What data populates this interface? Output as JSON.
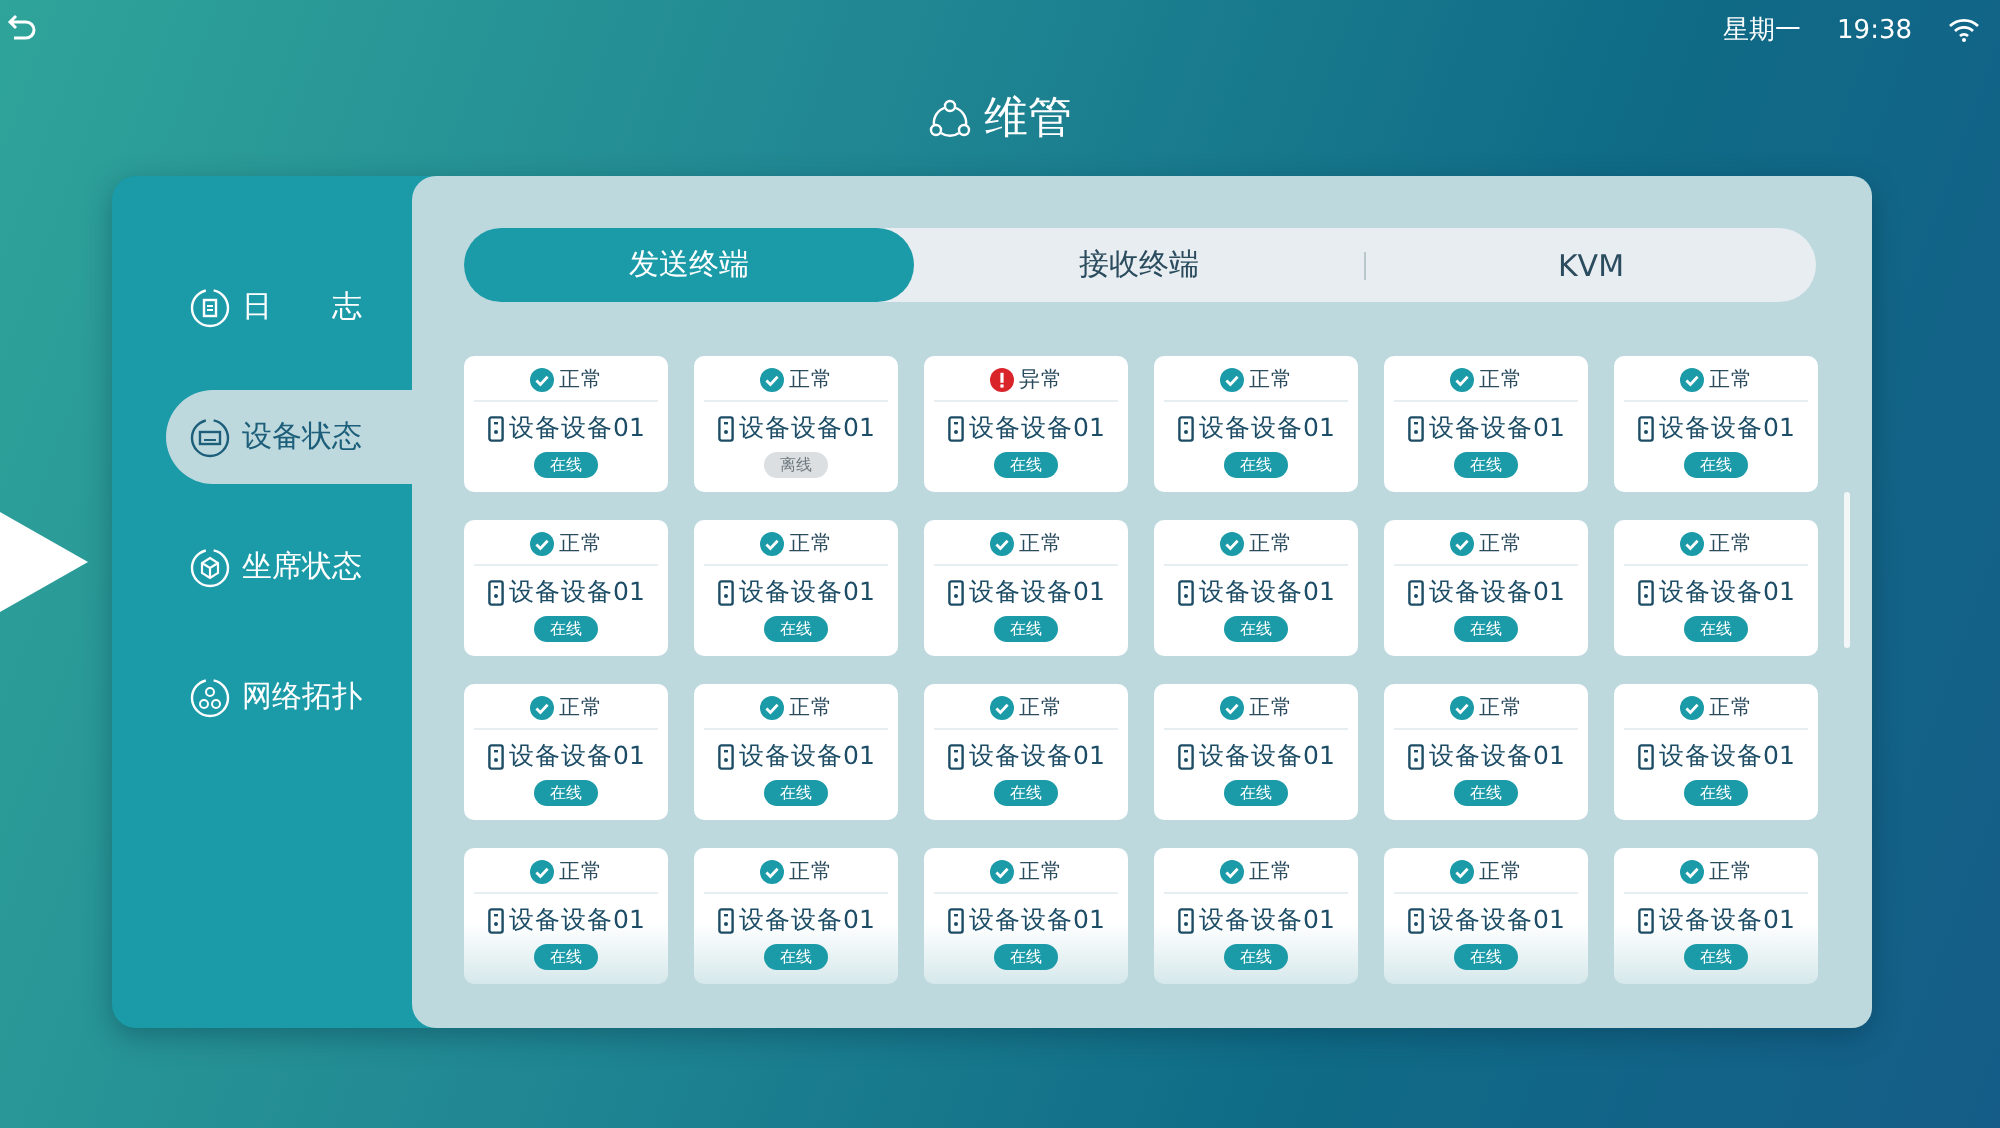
{
  "status_bar": {
    "weekday": "星期一",
    "time": "19:38"
  },
  "title": "维管",
  "sidebar": {
    "items": [
      {
        "label": "日　　志",
        "kind": "log",
        "selected": false
      },
      {
        "label": "设备状态",
        "kind": "device",
        "selected": true
      },
      {
        "label": "坐席状态",
        "kind": "seat",
        "selected": false
      },
      {
        "label": "网络拓扑",
        "kind": "network",
        "selected": false
      }
    ]
  },
  "tabs": [
    {
      "label": "发送终端",
      "selected": true
    },
    {
      "label": "接收终端",
      "selected": false
    },
    {
      "label": "KVM",
      "selected": false
    }
  ],
  "devices": [
    {
      "kind": "ok",
      "status_text": "正常",
      "name": "设备设备01",
      "online": true,
      "badge": "在线"
    },
    {
      "kind": "ok",
      "status_text": "正常",
      "name": "设备设备01",
      "online": false,
      "badge": "离线"
    },
    {
      "kind": "error",
      "status_text": "异常",
      "name": "设备设备01",
      "online": true,
      "badge": "在线"
    },
    {
      "kind": "ok",
      "status_text": "正常",
      "name": "设备设备01",
      "online": true,
      "badge": "在线"
    },
    {
      "kind": "ok",
      "status_text": "正常",
      "name": "设备设备01",
      "online": true,
      "badge": "在线"
    },
    {
      "kind": "ok",
      "status_text": "正常",
      "name": "设备设备01",
      "online": true,
      "badge": "在线"
    },
    {
      "kind": "ok",
      "status_text": "正常",
      "name": "设备设备01",
      "online": true,
      "badge": "在线"
    },
    {
      "kind": "ok",
      "status_text": "正常",
      "name": "设备设备01",
      "online": true,
      "badge": "在线"
    },
    {
      "kind": "ok",
      "status_text": "正常",
      "name": "设备设备01",
      "online": true,
      "badge": "在线"
    },
    {
      "kind": "ok",
      "status_text": "正常",
      "name": "设备设备01",
      "online": true,
      "badge": "在线"
    },
    {
      "kind": "ok",
      "status_text": "正常",
      "name": "设备设备01",
      "online": true,
      "badge": "在线"
    },
    {
      "kind": "ok",
      "status_text": "正常",
      "name": "设备设备01",
      "online": true,
      "badge": "在线"
    },
    {
      "kind": "ok",
      "status_text": "正常",
      "name": "设备设备01",
      "online": true,
      "badge": "在线"
    },
    {
      "kind": "ok",
      "status_text": "正常",
      "name": "设备设备01",
      "online": true,
      "badge": "在线"
    },
    {
      "kind": "ok",
      "status_text": "正常",
      "name": "设备设备01",
      "online": true,
      "badge": "在线"
    },
    {
      "kind": "ok",
      "status_text": "正常",
      "name": "设备设备01",
      "online": true,
      "badge": "在线"
    },
    {
      "kind": "ok",
      "status_text": "正常",
      "name": "设备设备01",
      "online": true,
      "badge": "在线"
    },
    {
      "kind": "ok",
      "status_text": "正常",
      "name": "设备设备01",
      "online": true,
      "badge": "在线"
    },
    {
      "kind": "ok",
      "status_text": "正常",
      "name": "设备设备01",
      "online": true,
      "badge": "在线"
    },
    {
      "kind": "ok",
      "status_text": "正常",
      "name": "设备设备01",
      "online": true,
      "badge": "在线"
    },
    {
      "kind": "ok",
      "status_text": "正常",
      "name": "设备设备01",
      "online": true,
      "badge": "在线"
    },
    {
      "kind": "ok",
      "status_text": "正常",
      "name": "设备设备01",
      "online": true,
      "badge": "在线"
    },
    {
      "kind": "ok",
      "status_text": "正常",
      "name": "设备设备01",
      "online": true,
      "badge": "在线"
    },
    {
      "kind": "ok",
      "status_text": "正常",
      "name": "设备设备01",
      "online": true,
      "badge": "在线"
    }
  ]
}
